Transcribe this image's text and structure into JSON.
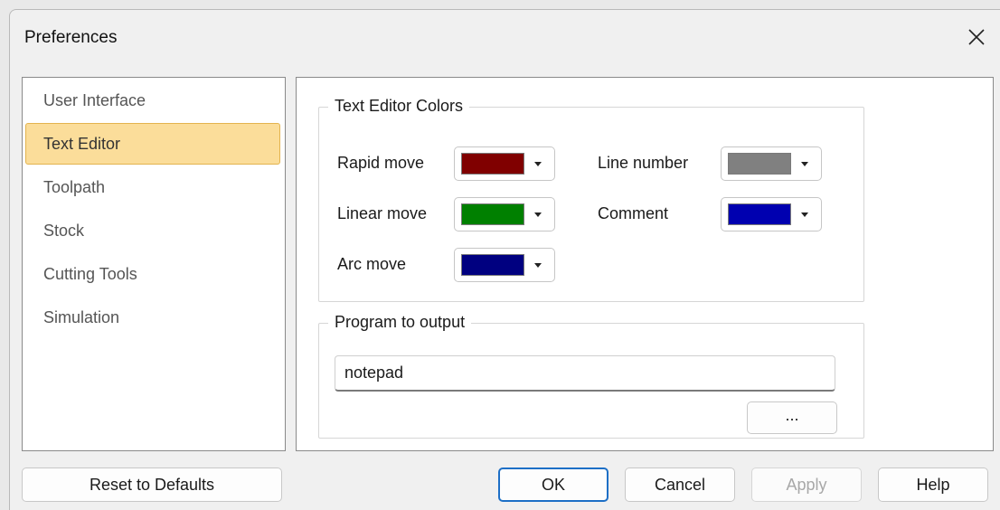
{
  "window": {
    "title": "Preferences"
  },
  "nav": {
    "items": [
      {
        "label": "User Interface",
        "selected": false
      },
      {
        "label": "Text Editor",
        "selected": true
      },
      {
        "label": "Toolpath",
        "selected": false
      },
      {
        "label": "Stock",
        "selected": false
      },
      {
        "label": "Cutting Tools",
        "selected": false
      },
      {
        "label": "Simulation",
        "selected": false
      }
    ]
  },
  "text_editor_colors": {
    "title": "Text Editor Colors",
    "rapid_move": {
      "label": "Rapid move",
      "color": "#800000"
    },
    "linear_move": {
      "label": "Linear move",
      "color": "#008000"
    },
    "arc_move": {
      "label": "Arc move",
      "color": "#000080"
    },
    "line_number": {
      "label": "Line number",
      "color": "#808080"
    },
    "comment": {
      "label": "Comment",
      "color": "#0000b0"
    }
  },
  "program_output": {
    "title": "Program to output",
    "value": "notepad",
    "browse_label": "..."
  },
  "buttons": {
    "reset": "Reset to Defaults",
    "ok": "OK",
    "cancel": "Cancel",
    "apply": "Apply",
    "help": "Help"
  },
  "colors": {
    "selection_bg": "#fbdd9a",
    "selection_border": "#e3b34e",
    "default_button_border": "#1d6fc6"
  }
}
